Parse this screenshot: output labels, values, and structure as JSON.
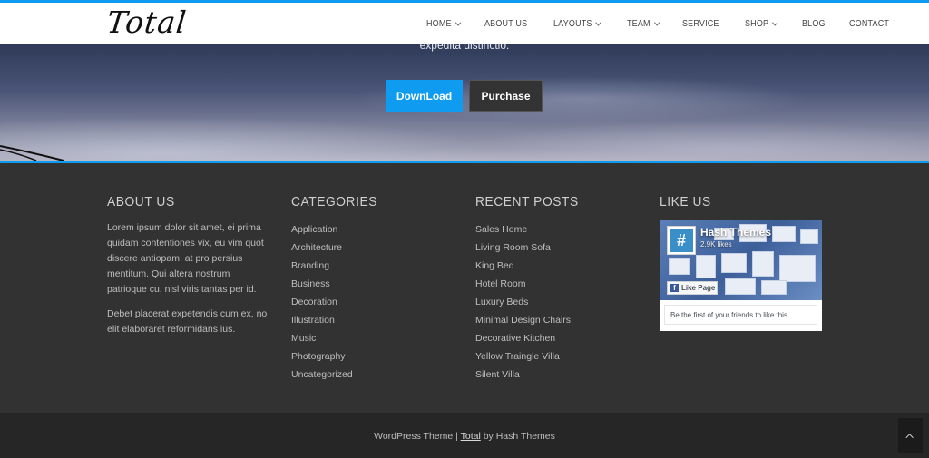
{
  "header": {
    "logo_text": "Total",
    "nav": [
      {
        "label": "HOME",
        "dropdown": true
      },
      {
        "label": "ABOUT US",
        "dropdown": false
      },
      {
        "label": "LAYOUTS",
        "dropdown": true
      },
      {
        "label": "TEAM",
        "dropdown": true
      },
      {
        "label": "SERVICE",
        "dropdown": false
      },
      {
        "label": "SHOP",
        "dropdown": true
      },
      {
        "label": "BLOG",
        "dropdown": false
      },
      {
        "label": "CONTACT",
        "dropdown": false
      }
    ]
  },
  "hero": {
    "subtitle": "expedita distinctio.",
    "download_label": "DownLoad",
    "purchase_label": "Purchase"
  },
  "footer": {
    "about": {
      "title": "ABOUT US",
      "para1": "Lorem ipsum dolor sit amet, ei prima quidam contentiones vix, eu vim quot discere antiopam, at pro persius mentitum. Qui altera nostrum patrioque cu, nisl viris tantas per id.",
      "para2": "Debet placerat expetendis cum ex, no elit elaboraret reformidans ius."
    },
    "categories": {
      "title": "CATEGORIES",
      "items": [
        "Application",
        "Architecture",
        "Branding",
        "Business",
        "Decoration",
        "Illustration",
        "Music",
        "Photography",
        "Uncategorized"
      ]
    },
    "recent_posts": {
      "title": "RECENT POSTS",
      "items": [
        "Sales Home",
        "Living Room Sofa",
        "King Bed",
        "Hotel Room",
        "Luxury Beds",
        "Minimal Design Chairs",
        "Decorative Kitchen",
        "Yellow Traingle Villa",
        "Silent Villa"
      ]
    },
    "like_us": {
      "title": "LIKE US",
      "page_name": "Hash Themes",
      "likes": "2.9K likes",
      "like_button": "Like Page",
      "friends_text": "Be the first of your friends to like this"
    }
  },
  "bottom": {
    "prefix": "WordPress Theme | ",
    "theme_link": "Total",
    "suffix": " by Hash Themes"
  },
  "colors": {
    "accent": "#0f9cf0",
    "footer_bg": "#323232",
    "bottom_bg": "#262626"
  },
  "icons": {
    "scroll_top": "chevron-up-icon",
    "nav_dropdown": "chevron-down-icon"
  }
}
